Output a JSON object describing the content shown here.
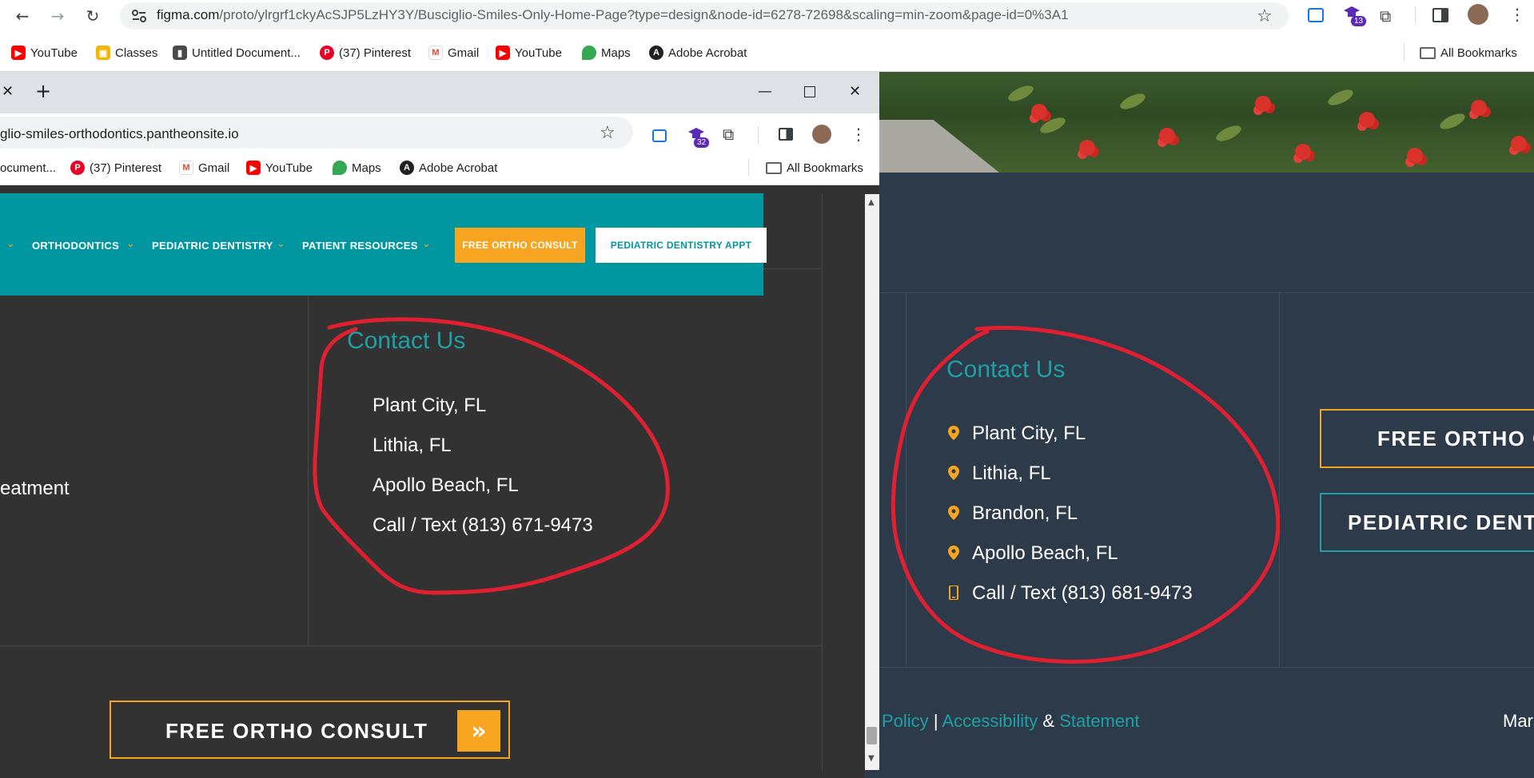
{
  "outer_browser": {
    "url_host": "figma.com",
    "url_path": "/proto/ylrgrf1ckyAcSJP5LzHY3Y/Busciglio-Smiles-Only-Home-Page?type=design&node-id=6278-72698&scaling=min-zoom&page-id=0%3A1",
    "extension_badge": "13",
    "bookmarks": [
      "YouTube",
      "Classes",
      "Untitled Document...",
      "(37) Pinterest",
      "Gmail",
      "YouTube",
      "Maps",
      "Adobe Acrobat"
    ],
    "all_bookmarks": "All Bookmarks"
  },
  "inner_browser": {
    "url": "glio-smiles-orthodontics.pantheonsite.io",
    "extension_badge": "32",
    "bookmarks": [
      "ocument...",
      "(37) Pinterest",
      "Gmail",
      "YouTube",
      "Maps",
      "Adobe Acrobat"
    ],
    "all_bookmarks": "All Bookmarks"
  },
  "live_site": {
    "nav_items": [
      "ORTHODONTICS",
      "PEDIATRIC DENTISTRY",
      "PATIENT RESOURCES"
    ],
    "nav_button_ortho": "FREE ORTHO CONSULT",
    "nav_button_pedi": "PEDIATRIC DENTISTRY APPT",
    "left_text": "eatment",
    "contact_title": "Contact Us",
    "contact_items": [
      "Plant City, FL",
      "Lithia, FL",
      "Apollo Beach, FL",
      "Call / Text (813) 671-9473"
    ],
    "cta_button": "FREE ORTHO CONSULT",
    "cta_arrow": "»"
  },
  "figma_design": {
    "contact_title": "Contact Us",
    "contact_items": [
      "Plant City, FL",
      "Lithia, FL",
      "Brandon, FL",
      "Apollo Beach, FL",
      "Call / Text (813) 681-9473"
    ],
    "button_ortho": "FREE ORTHO C",
    "button_pedi": "PEDIATRIC DENTI",
    "footer_policy": "Policy",
    "footer_sep": "|",
    "footer_accessibility": "Accessibility",
    "footer_amp": "&",
    "footer_statement": "Statement",
    "footer_right": "Mar"
  },
  "colors": {
    "teal": "#1fa0a4",
    "orange": "#f7a520",
    "annotation_red": "#e02030",
    "design_bg": "#2d3a4a",
    "live_bg": "#323233"
  }
}
